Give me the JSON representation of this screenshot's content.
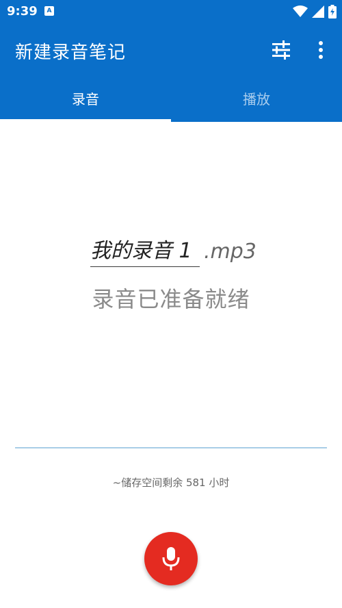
{
  "status_bar": {
    "time": "9:39",
    "app_icon_glyph": "A",
    "icons": [
      "wifi-icon",
      "signal-icon",
      "battery-icon"
    ]
  },
  "app_bar": {
    "title": "新建录音笔记",
    "actions": [
      "tune-icon",
      "more-vert-icon"
    ]
  },
  "tabs": [
    {
      "label": "录音",
      "active": true
    },
    {
      "label": "播放",
      "active": false
    }
  ],
  "recording": {
    "filename": "我的录音 1",
    "extension": ".mp3",
    "status": "录音已准备就绪",
    "storage": "~储存空间剩余 581 小时"
  },
  "colors": {
    "primary": "#0a6fc9",
    "record": "#e42b21",
    "level_line": "#a8cde6",
    "tab_inactive": "#a9cdee"
  }
}
